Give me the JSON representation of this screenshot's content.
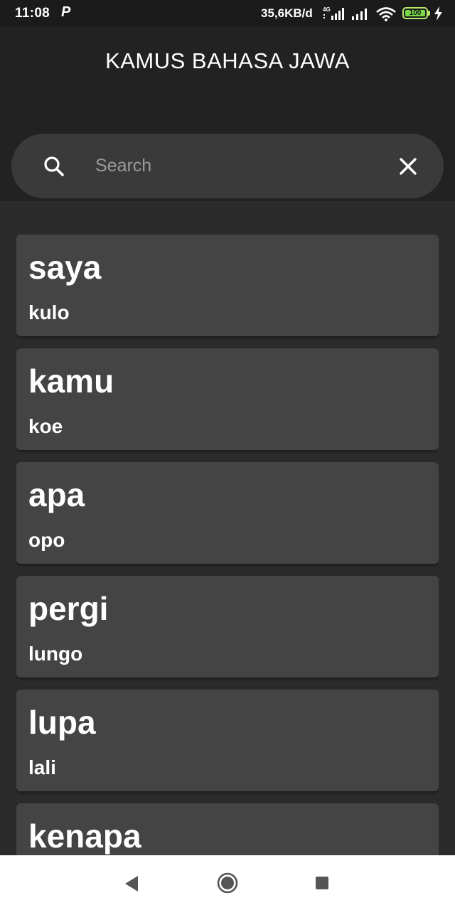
{
  "status_bar": {
    "time": "11:08",
    "p_icon": "P",
    "network_speed": "35,6KB/d",
    "network_type": "4G",
    "battery_level": "100",
    "icons": [
      "p-notification-icon",
      "signal-4g-icon",
      "signal-icon",
      "wifi-icon",
      "battery-icon",
      "charging-icon"
    ]
  },
  "header": {
    "title": "KAMUS BAHASA JAWA"
  },
  "search": {
    "placeholder": "Search",
    "value": ""
  },
  "words": [
    {
      "term": "saya",
      "translation": "kulo"
    },
    {
      "term": "kamu",
      "translation": "koe"
    },
    {
      "term": "apa",
      "translation": "opo"
    },
    {
      "term": "pergi",
      "translation": "lungo"
    },
    {
      "term": "lupa",
      "translation": "lali"
    },
    {
      "term": "kenapa",
      "translation": ""
    }
  ],
  "nav_bar": {
    "icons": [
      "back-icon",
      "home-icon",
      "recents-icon"
    ]
  },
  "colors": {
    "status_bar_bg": "#1b1b1b",
    "header_bg": "#222222",
    "search_bg": "#3a3a3a",
    "list_bg": "#2b2b2b",
    "card_bg": "#444444",
    "text": "#ffffff",
    "battery_green": "#7ad84a"
  }
}
